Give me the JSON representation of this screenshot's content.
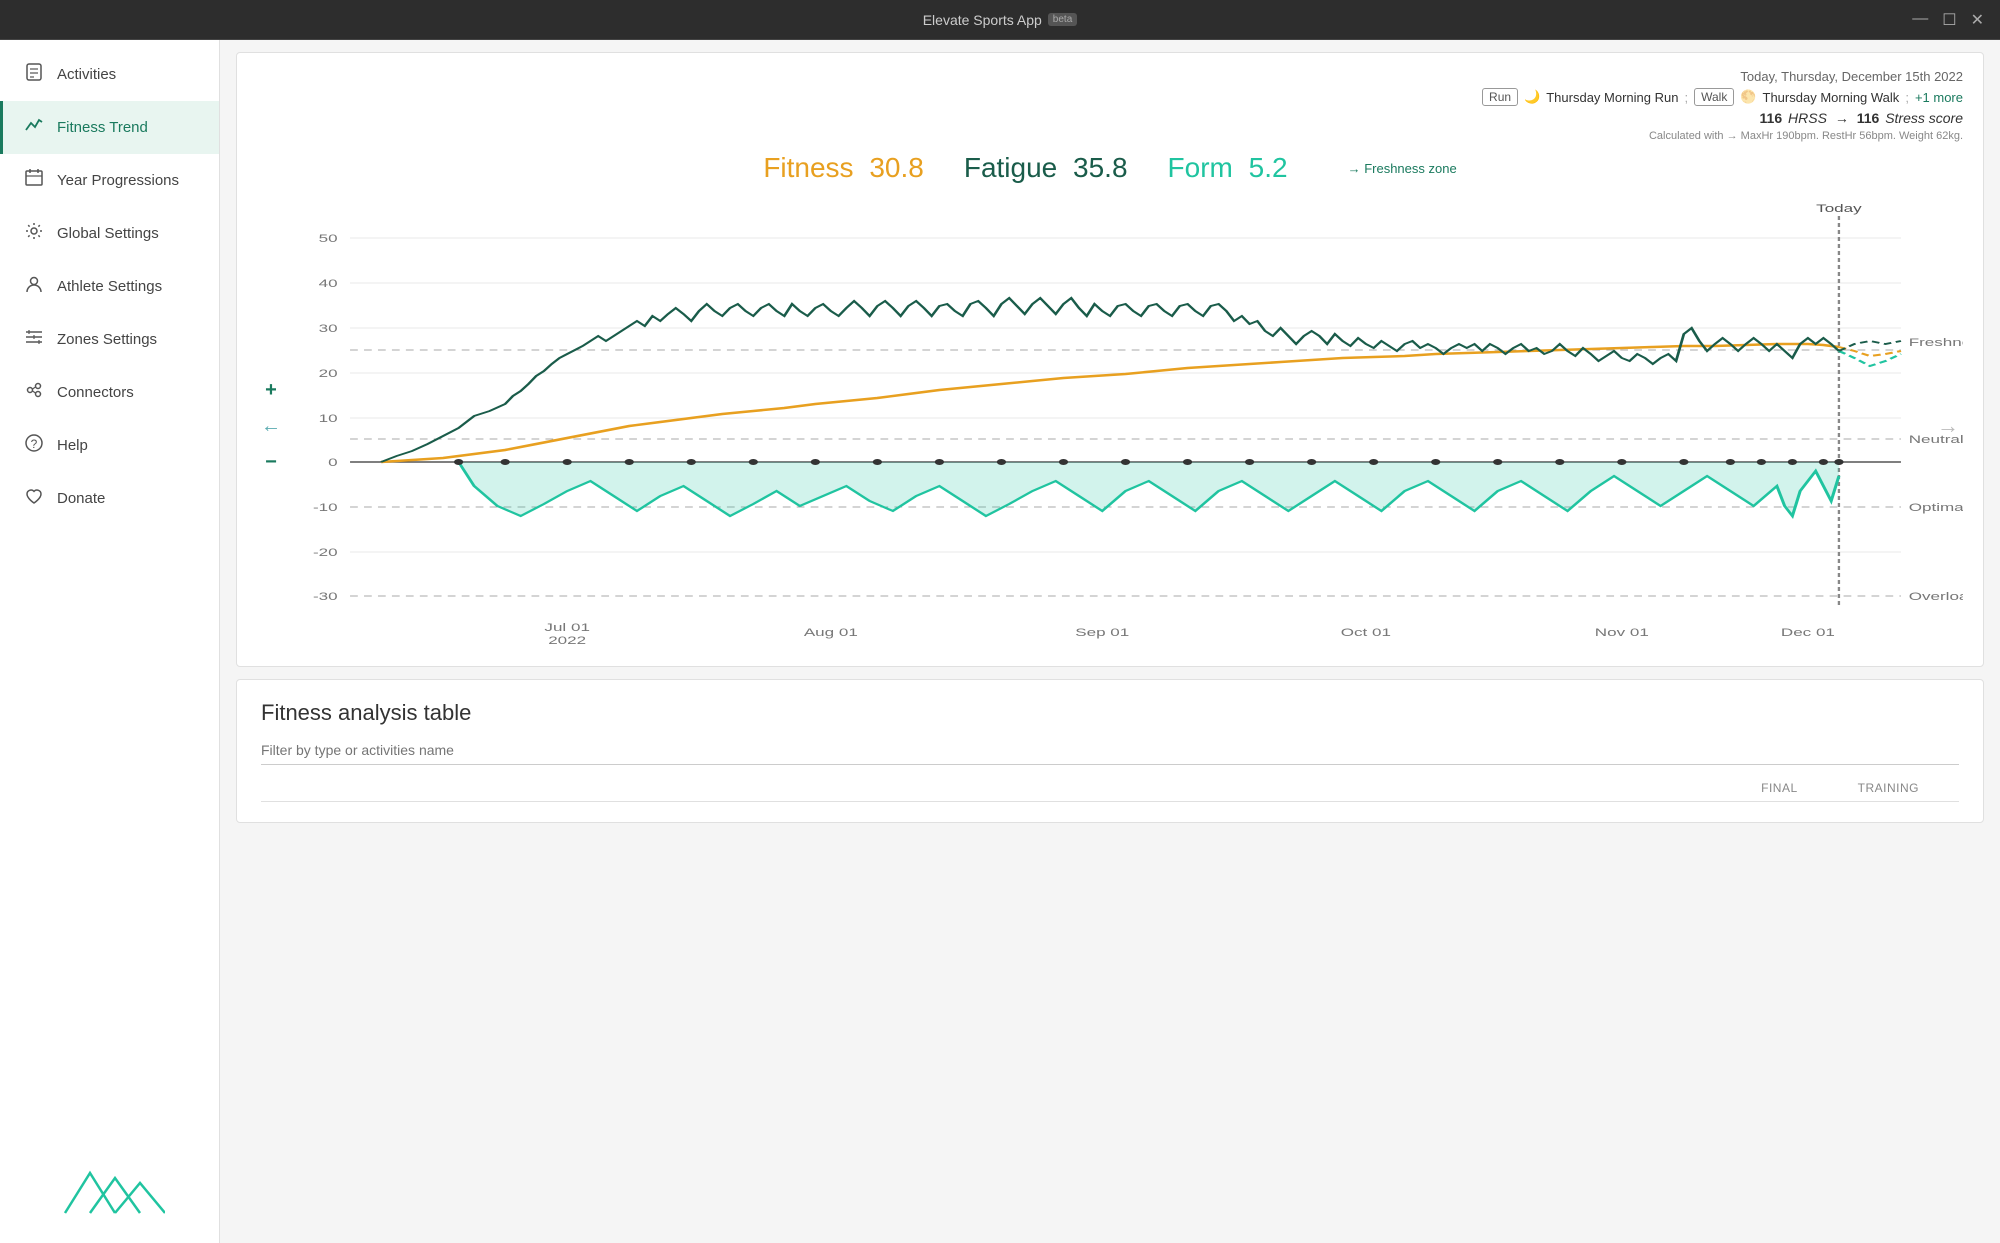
{
  "titlebar": {
    "title": "Elevate Sports App",
    "badge": "beta",
    "minimize": "—",
    "maximize": "☐",
    "close": "✕"
  },
  "sidebar": {
    "items": [
      {
        "id": "activities",
        "label": "Activities",
        "icon": "📄"
      },
      {
        "id": "fitness-trend",
        "label": "Fitness Trend",
        "icon": "〜",
        "active": true
      },
      {
        "id": "year-progressions",
        "label": "Year Progressions",
        "icon": "📅"
      },
      {
        "id": "global-settings",
        "label": "Global Settings",
        "icon": "⚙"
      },
      {
        "id": "athlete-settings",
        "label": "Athlete Settings",
        "icon": "👤"
      },
      {
        "id": "zones-settings",
        "label": "Zones Settings",
        "icon": "☰"
      },
      {
        "id": "connectors",
        "label": "Connectors",
        "icon": "🔌"
      },
      {
        "id": "help",
        "label": "Help",
        "icon": "⊙"
      },
      {
        "id": "donate",
        "label": "Donate",
        "icon": "♡"
      }
    ]
  },
  "chart_header": {
    "date": "Today, Thursday, December 15th 2022",
    "run_badge": "Run",
    "run_emoji": "🌙",
    "run_activity": "Thursday Morning Run",
    "walk_badge": "Walk",
    "walk_emoji": "🌕",
    "walk_activity": "Thursday Morning Walk",
    "more": "+1 more",
    "hrss_value1": "116",
    "hrss_label": "HRSS",
    "hrss_arrow": "→",
    "hrss_value2": "116",
    "stress_label": "Stress score",
    "calc_text": "Calculated with → MaxHr 190bpm. RestHr 56bpm. Weight 62kg."
  },
  "metrics": {
    "fitness_label": "Fitness",
    "fitness_value": "30.8",
    "fatigue_label": "Fatigue",
    "fatigue_value": "35.8",
    "form_label": "Form",
    "form_value": "5.2",
    "freshness_zone": "→ Freshness zone"
  },
  "chart": {
    "today_label": "Today",
    "y_labels": [
      "50",
      "40",
      "30",
      "20",
      "10",
      "0",
      "-10",
      "-20",
      "-30"
    ],
    "x_labels": [
      "Jul 01\n2022",
      "Aug 01",
      "Sep 01",
      "Oct 01",
      "Nov 01",
      "Dec 01"
    ],
    "zone_labels": {
      "freshness": "Freshness",
      "neutral": "Neutral",
      "optimal": "Optimal",
      "overload": "Overload"
    },
    "controls": {
      "plus": "+",
      "arrow": "←",
      "minus": "−"
    },
    "right_arrow": "→"
  },
  "analysis": {
    "title": "Fitness analysis table",
    "filter_placeholder": "Filter by type or activities name",
    "columns": [
      "Final",
      "Training"
    ]
  }
}
